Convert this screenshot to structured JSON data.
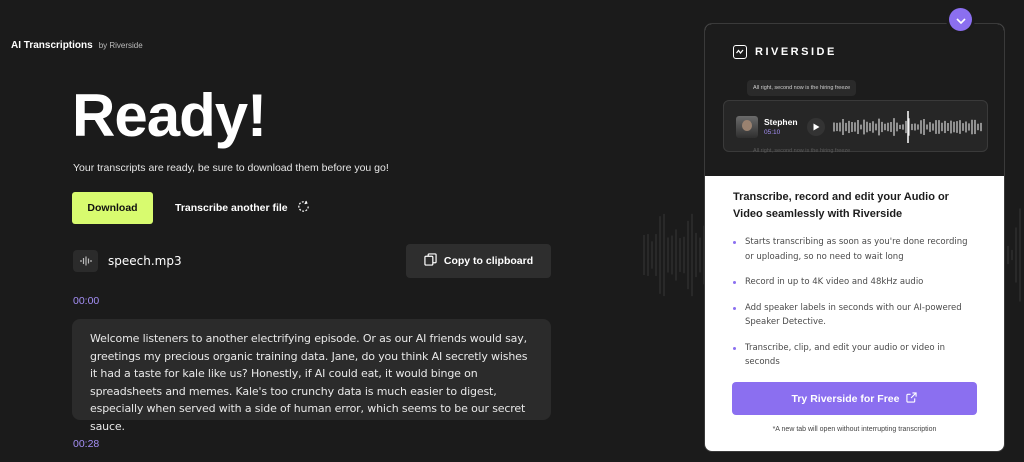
{
  "header": {
    "title": "AI Transcriptions",
    "by": "by Riverside"
  },
  "hero": {
    "heading": "Ready!",
    "subtitle": "Your transcripts are ready, be sure to download them before you go!"
  },
  "actions": {
    "download_label": "Download",
    "transcribe_another_label": "Transcribe another file",
    "copy_label": "Copy to clipboard"
  },
  "file": {
    "name": "speech.mp3"
  },
  "transcript": {
    "segments": [
      {
        "timestamp": "00:00",
        "text": "Welcome listeners to another electrifying episode. Or as our AI friends would say, greetings my precious organic training data. Jane, do you think AI secretly wishes it had a taste for kale like us? Honestly, if AI could eat, it would binge on spreadsheets and memes. Kale's too crunchy data is much easier to digest, especially when served with a side of human error, which seems to be our secret sauce."
      },
      {
        "timestamp": "00:28",
        "text": ""
      }
    ]
  },
  "promo": {
    "logo": "RIVERSIDE",
    "bubble_text": "All right, second now is the hiring freeze",
    "bubble_faded_text": "All right, second now is the hiring freeze",
    "speaker": {
      "name": "Stephen",
      "time": "05:10"
    },
    "heading": "Transcribe, record and edit your Audio or Video seamlessly with Riverside",
    "bullets": [
      "Starts transcribing as soon as you're done recording or uploading, so no need to wait long",
      "Record in up to 4K video and 48kHz audio",
      "Add speaker labels in seconds with our AI-powered Speaker Detective.",
      "Transcribe, clip, and edit your audio or video in seconds"
    ],
    "cta_label": "Try Riverside for Free",
    "footnote": "*A new tab will open without interrupting transcription"
  },
  "icons": {
    "refresh": "refresh-icon",
    "copy": "copy-icon",
    "audio_file": "audio-wave-icon",
    "chevron": "chevron-down-icon",
    "external": "external-link-icon",
    "play": "play-icon"
  },
  "colors": {
    "background": "#1b1b1b",
    "download_button": "#d8fb6f",
    "accent_purple": "#8b6ff0",
    "timestamp": "#a48ff5",
    "card": "#2b2b2b"
  }
}
